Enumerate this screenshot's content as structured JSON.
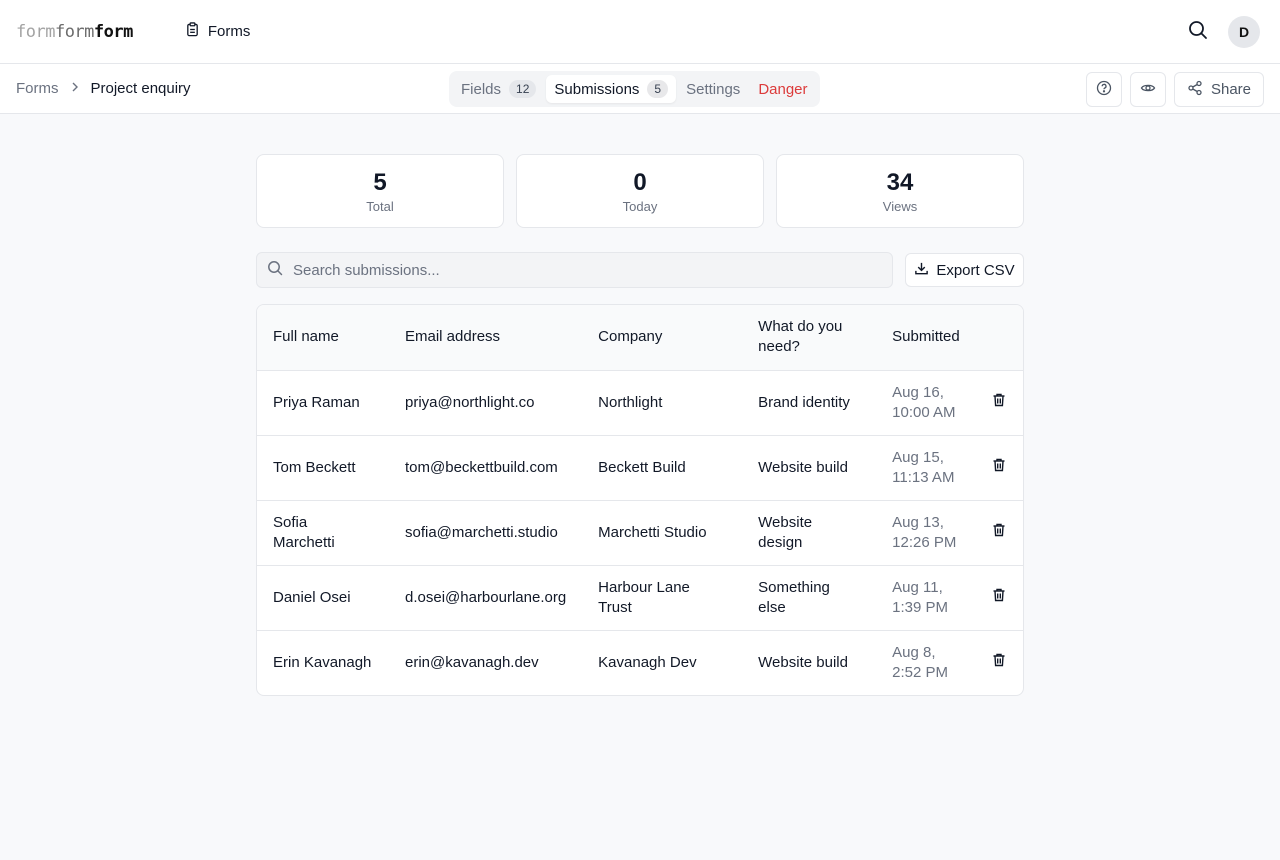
{
  "app": {
    "logo_parts": [
      "form",
      "form",
      "form"
    ],
    "nav_forms": "Forms",
    "avatar_initial": "D"
  },
  "breadcrumb": {
    "parent": "Forms",
    "current": "Project enquiry"
  },
  "tabs": [
    {
      "label": "Fields",
      "count": "12"
    },
    {
      "label": "Submissions",
      "count": "5"
    },
    {
      "label": "Settings"
    },
    {
      "label": "Danger"
    }
  ],
  "actions": {
    "share_label": "Share"
  },
  "stats": [
    {
      "value": "5",
      "label": "Total"
    },
    {
      "value": "0",
      "label": "Today"
    },
    {
      "value": "34",
      "label": "Views"
    }
  ],
  "search": {
    "placeholder": "Search submissions...",
    "value": ""
  },
  "export_label": "Export CSV",
  "table": {
    "headers": [
      "Full name",
      "Email address",
      "Company",
      "What do you need?",
      "Submitted"
    ],
    "rows": [
      {
        "name": "Priya Raman",
        "email": "priya@northlight.co",
        "company": "Northlight",
        "need": "Brand identity",
        "date": "Aug 16,",
        "time": "10:00 AM"
      },
      {
        "name": "Tom Beckett",
        "email": "tom@beckettbuild.com",
        "company": "Beckett Build",
        "need": "Website build",
        "date": "Aug 15,",
        "time": "11:13 AM"
      },
      {
        "name": "Sofia Marchetti",
        "email": "sofia@marchetti.studio",
        "company": "Marchetti Studio",
        "need": "Website design",
        "date": "Aug 13,",
        "time": "12:26 PM"
      },
      {
        "name": "Daniel Osei",
        "email": "d.osei@harbourlane.org",
        "company": "Harbour Lane Trust",
        "need": "Something else",
        "date": "Aug 11,",
        "time": "1:39 PM"
      },
      {
        "name": "Erin Kavanagh",
        "email": "erin@kavanagh.dev",
        "company": "Kavanagh Dev",
        "need": "Website build",
        "date": "Aug 8,",
        "time": "2:52 PM"
      }
    ]
  },
  "colors": {
    "danger": "#dc3b3b",
    "muted": "#6b7280",
    "border": "#e5e7eb"
  }
}
